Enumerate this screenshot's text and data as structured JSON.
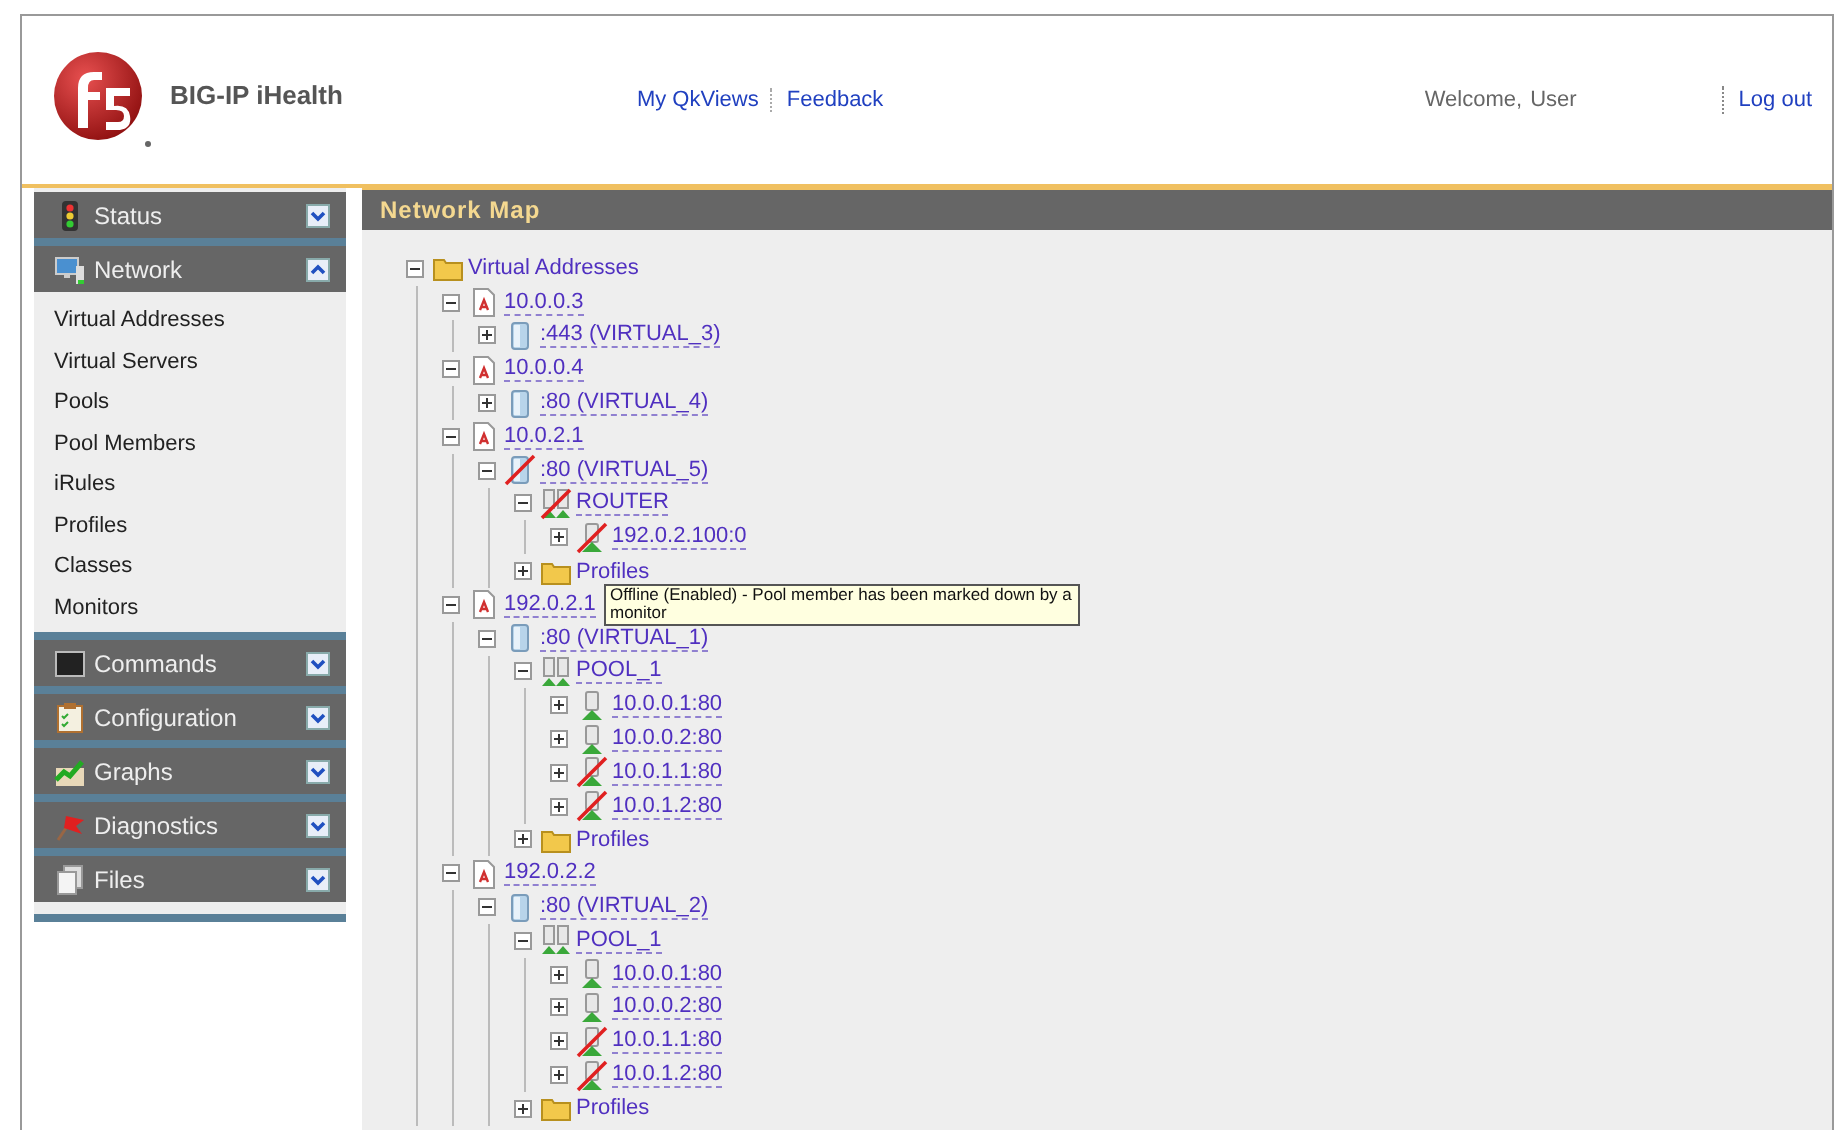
{
  "header": {
    "product": "BIG-IP iHealth",
    "links": [
      "My QkViews",
      "Feedback"
    ],
    "welcome": "Welcome,",
    "user": "User",
    "logout": "Log out"
  },
  "sidebar": [
    {
      "label": "Status",
      "expanded": false
    },
    {
      "label": "Network",
      "expanded": true,
      "items": [
        "Virtual Addresses",
        "Virtual Servers",
        "Pools",
        "Pool Members",
        "iRules",
        "Profiles",
        "Classes",
        "Monitors"
      ]
    },
    {
      "label": "Commands",
      "expanded": false
    },
    {
      "label": "Configuration",
      "expanded": false
    },
    {
      "label": "Graphs",
      "expanded": false
    },
    {
      "label": "Diagnostics",
      "expanded": false
    },
    {
      "label": "Files",
      "expanded": false
    }
  ],
  "panel": {
    "title": "Network Map"
  },
  "tree": [
    {
      "kind": "folder",
      "label": "Virtual Addresses",
      "expanded": true,
      "offline": false,
      "children": [
        {
          "kind": "address",
          "label": "10.0.0.3",
          "expanded": true,
          "offline": false,
          "children": [
            {
              "kind": "virtual",
              "label": ":443 (VIRTUAL_3)",
              "expanded": false,
              "offline": false
            }
          ]
        },
        {
          "kind": "address",
          "label": "10.0.0.4",
          "expanded": true,
          "offline": false,
          "children": [
            {
              "kind": "virtual",
              "label": ":80 (VIRTUAL_4)",
              "expanded": false,
              "offline": false
            }
          ]
        },
        {
          "kind": "address",
          "label": "10.0.2.1",
          "expanded": true,
          "offline": false,
          "children": [
            {
              "kind": "virtual",
              "label": ":80 (VIRTUAL_5)",
              "expanded": true,
              "offline": true,
              "children": [
                {
                  "kind": "pool",
                  "label": "ROUTER",
                  "expanded": true,
                  "offline": true,
                  "children": [
                    {
                      "kind": "member",
                      "label": "192.0.2.100:0",
                      "expanded": false,
                      "offline": true
                    }
                  ]
                },
                {
                  "kind": "folder",
                  "label": "Profiles",
                  "expanded": false,
                  "offline": false
                }
              ]
            }
          ]
        },
        {
          "kind": "address",
          "label": "192.0.2.1",
          "expanded": true,
          "offline": false,
          "children": [
            {
              "kind": "virtual",
              "label": ":80 (VIRTUAL_1)",
              "expanded": true,
              "offline": false,
              "children": [
                {
                  "kind": "pool",
                  "label": "POOL_1",
                  "expanded": true,
                  "offline": false,
                  "children": [
                    {
                      "kind": "member",
                      "label": "10.0.0.1:80",
                      "expanded": false,
                      "offline": false
                    },
                    {
                      "kind": "member",
                      "label": "10.0.0.2:80",
                      "expanded": false,
                      "offline": false
                    },
                    {
                      "kind": "member",
                      "label": "10.0.1.1:80",
                      "expanded": false,
                      "offline": true
                    },
                    {
                      "kind": "member",
                      "label": "10.0.1.2:80",
                      "expanded": false,
                      "offline": true
                    }
                  ]
                },
                {
                  "kind": "folder",
                  "label": "Profiles",
                  "expanded": false,
                  "offline": false
                }
              ]
            }
          ]
        },
        {
          "kind": "address",
          "label": "192.0.2.2",
          "expanded": true,
          "offline": false,
          "children": [
            {
              "kind": "virtual",
              "label": ":80 (VIRTUAL_2)",
              "expanded": true,
              "offline": false,
              "children": [
                {
                  "kind": "pool",
                  "label": "POOL_1",
                  "expanded": true,
                  "offline": false,
                  "children": [
                    {
                      "kind": "member",
                      "label": "10.0.0.1:80",
                      "expanded": false,
                      "offline": false
                    },
                    {
                      "kind": "member",
                      "label": "10.0.0.2:80",
                      "expanded": false,
                      "offline": false
                    },
                    {
                      "kind": "member",
                      "label": "10.0.1.1:80",
                      "expanded": false,
                      "offline": true
                    },
                    {
                      "kind": "member",
                      "label": "10.0.1.2:80",
                      "expanded": false,
                      "offline": true
                    }
                  ]
                },
                {
                  "kind": "folder",
                  "label": "Profiles",
                  "expanded": false,
                  "offline": false
                }
              ]
            }
          ]
        }
      ]
    }
  ],
  "tooltip": "Offline (Enabled) - Pool member has been marked down by a monitor"
}
